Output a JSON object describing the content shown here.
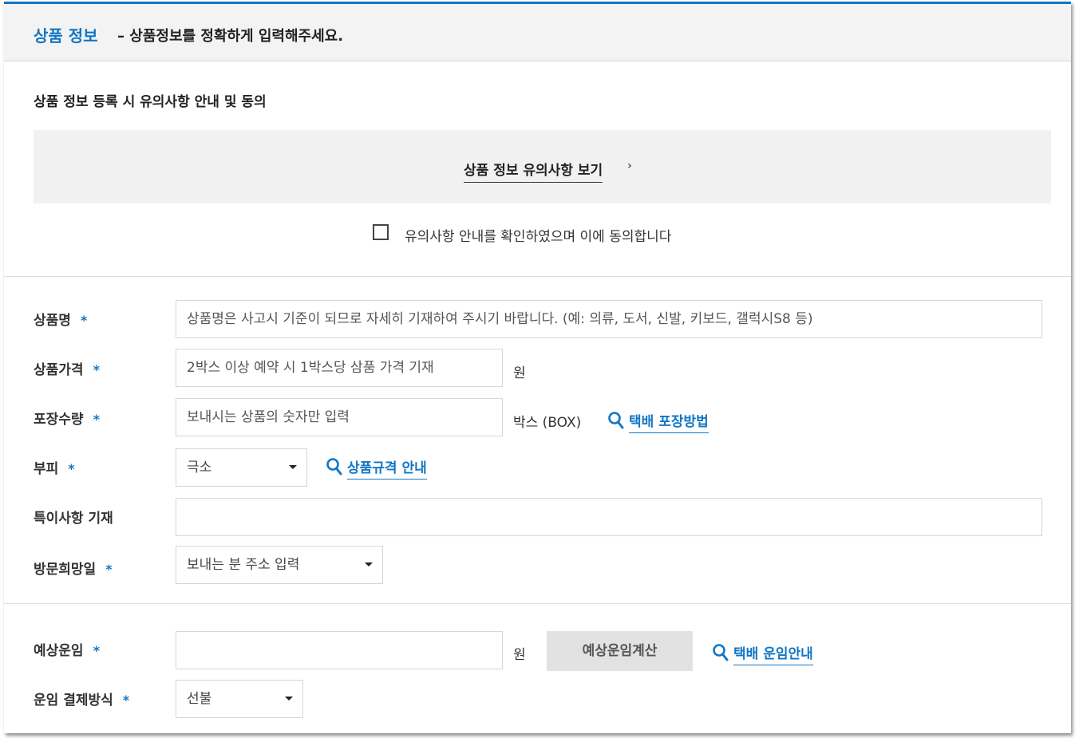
{
  "header": {
    "title": "상품 정보",
    "subtitle": "– 상품정보를 정확하게 입력해주세요."
  },
  "notice": {
    "label": "상품 정보 등록 시 유의사항 안내 및 동의",
    "link_text": "상품 정보 유의사항 보기",
    "link_arrow": "›",
    "agree_text": "유의사항 안내를 확인하였으며 이에 동의합니다",
    "agree_checked": false
  },
  "form": {
    "required_mark": "*",
    "product_name": {
      "label": "상품명",
      "placeholder": "상품명은 사고시 기준이 되므로 자세히 기재하여 주시기 바랍니다. (예: 의류, 도서, 신발, 키보드, 갤럭시S8 등)"
    },
    "product_price": {
      "label": "상품가격",
      "placeholder": "2박스 이상 예약 시 1박스당 삼품 가격 기재",
      "unit": "원"
    },
    "package_qty": {
      "label": "포장수량",
      "placeholder": "보내시는 상품의 숫자만 입력",
      "unit": "박스 (BOX)",
      "guide_link": "택배 포장방법"
    },
    "volume": {
      "label": "부피",
      "selected": "극소",
      "guide_link": "상품규격 안내"
    },
    "special_notes": {
      "label": "특이사항 기재",
      "value": ""
    },
    "visit_date": {
      "label": "방문희망일",
      "selected": "보내는 분 주소 입력"
    }
  },
  "fare": {
    "estimated": {
      "label": "예상운임",
      "value": "",
      "unit": "원",
      "calc_button": "예상운임계산",
      "guide_link": "택배 운임안내"
    },
    "payment": {
      "label": "운임 결제방식",
      "selected": "선불"
    }
  },
  "colors": {
    "accent": "#1177c5",
    "header_bg": "#f3f3f3",
    "notice_bg": "#f1f1f1",
    "button_bg": "#e2e2e2"
  },
  "icons": {
    "guide_link_icon": "magnifier-icon",
    "select_icon": "caret-down-icon",
    "notice_link_icon": "chevron-right-icon"
  }
}
